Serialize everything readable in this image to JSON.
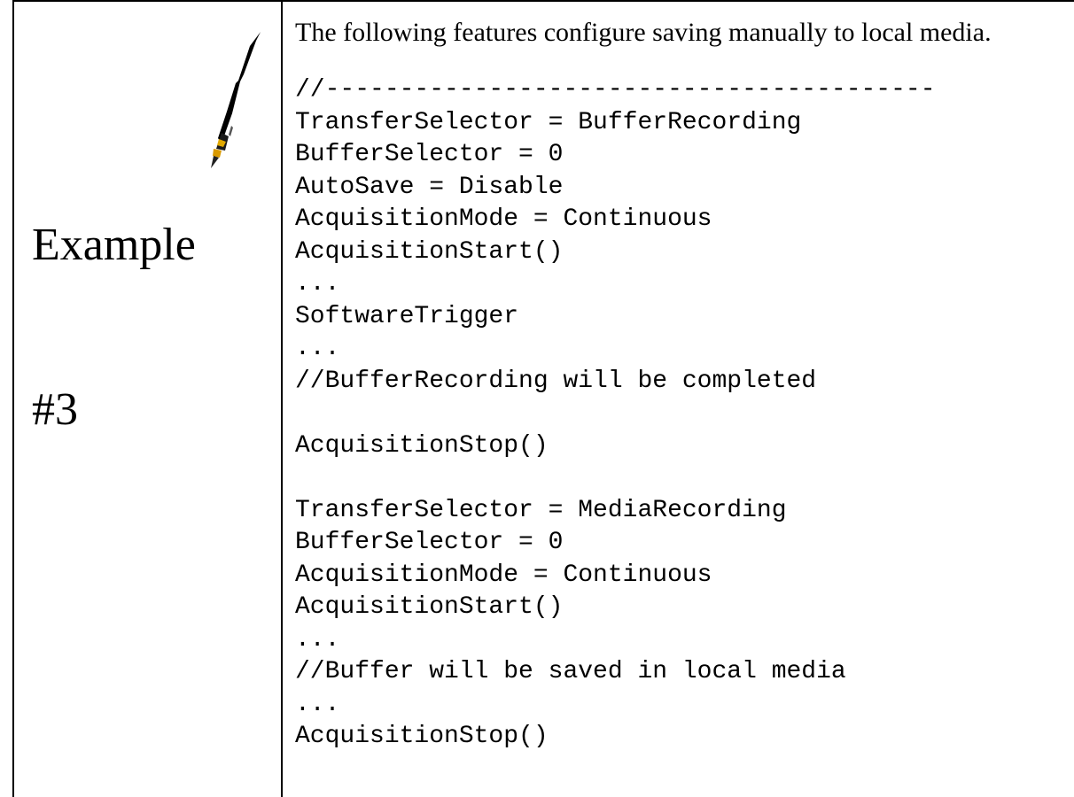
{
  "example": {
    "label_line1": "Example",
    "label_line2": "#3",
    "icon": "pen-icon"
  },
  "intro": "The following features configure saving manually to local media.",
  "code_lines": [
    "//-----------------------------------------",
    "TransferSelector = BufferRecording",
    "BufferSelector = 0",
    "AutoSave = Disable",
    "AcquisitionMode = Continuous",
    "AcquisitionStart()",
    "...",
    "SoftwareTrigger",
    "...",
    "//BufferRecording will be completed",
    "",
    "AcquisitionStop()",
    "",
    "TransferSelector = MediaRecording",
    "BufferSelector = 0",
    "AcquisitionMode = Continuous",
    "AcquisitionStart()",
    "...",
    "//Buffer will be saved in local media",
    "...",
    "AcquisitionStop()"
  ]
}
